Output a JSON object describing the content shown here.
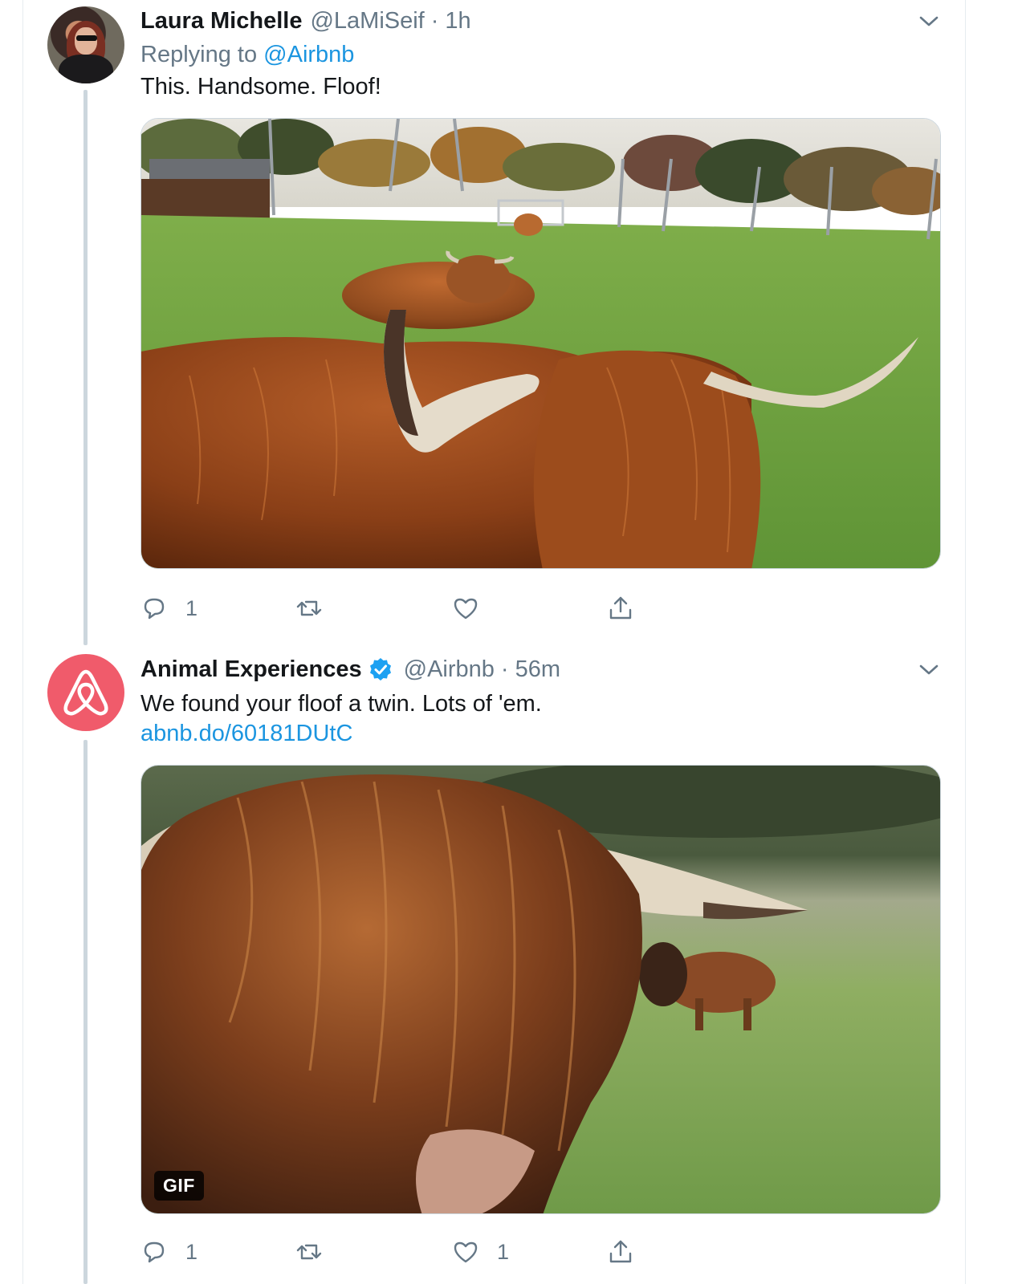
{
  "tweets": [
    {
      "author_name": "Laura Michelle",
      "handle": "@LaMiSeif",
      "separator": "·",
      "time": "1h",
      "replying_prefix": "Replying to",
      "replying_to": "@Airbnb",
      "text": "This. Handsome. Floof!",
      "media_icon": "photo-highland-cattle",
      "actions": {
        "reply_count": "1",
        "retweet_count": "",
        "like_count": ""
      }
    },
    {
      "author_name": "Animal Experiences",
      "verified": true,
      "handle": "@Airbnb",
      "separator": "·",
      "time": "56m",
      "text": "We found your floof a twin. Lots of 'em.",
      "link": "abnb.do/60181DUtC",
      "media_icon": "gif-highland-cattle",
      "media_badge": "GIF",
      "actions": {
        "reply_count": "1",
        "retweet_count": "",
        "like_count": "1"
      }
    }
  ],
  "colors": {
    "link": "#1b95e0",
    "secondary_text": "#657786",
    "primary_text": "#14171a",
    "thread_line": "#ccd6dd",
    "airbnb_brand": "#f05b6b"
  }
}
